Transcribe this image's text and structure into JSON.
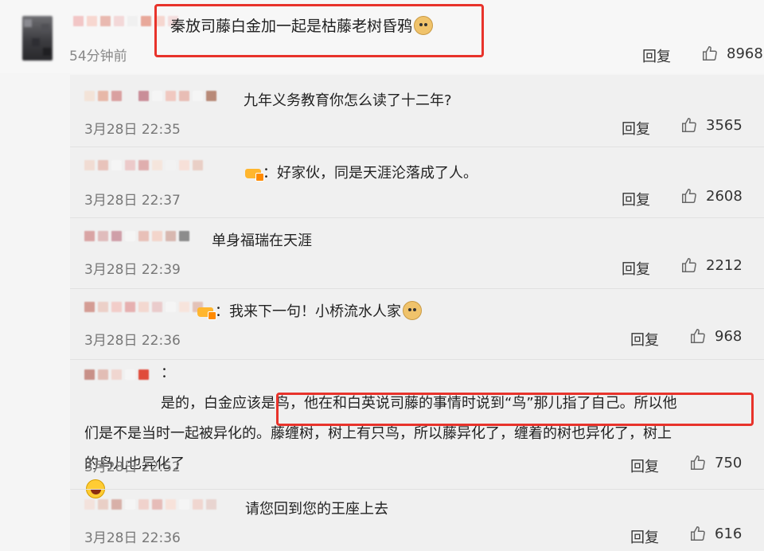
{
  "top_comment": {
    "time": "54分钟前",
    "text": "秦放司藤白金加一起是枯藤老树昏鸦",
    "emoji": "doge-icon",
    "reply_label": "回复",
    "likes": "8968"
  },
  "sub_comments": [
    {
      "text": "九年义务教育你怎么读了十二年?",
      "time": "3月28日 22:35",
      "reply_label": "回复",
      "likes": "3565"
    },
    {
      "text": "好家伙，同是天涯沦落成了人。",
      "time": "3月28日 22:37",
      "reply_label": "回复",
      "likes": "2608"
    },
    {
      "text": "单身福瑞在天涯",
      "time": "3月28日 22:39",
      "reply_label": "回复",
      "likes": "2212"
    },
    {
      "text": "我来下一句！小桥流水人家",
      "time": "3月28日 22:36",
      "reply_label": "回复",
      "likes": "968"
    },
    {
      "line1": "是的，白金应该是鸟，他在和白英说司藤的事情时说到“鸟”那儿指了自己。所以他",
      "line2": "们是不是当时一起被异化的。藤缠树，树上有只鸟，所以藤异化了，缠着的树也异化了，树上",
      "line3": "的鸟儿也异化了",
      "time": "3月28日 22:52",
      "reply_label": "回复",
      "likes": "750"
    },
    {
      "text": "请您回到您的王座上去",
      "time": "3月28日 22:36",
      "reply_label": "回复",
      "likes": "616"
    }
  ],
  "colors": {
    "highlight_box": "#e8332b",
    "background": "#f5f5f5",
    "panel": "#f0f0f0"
  }
}
